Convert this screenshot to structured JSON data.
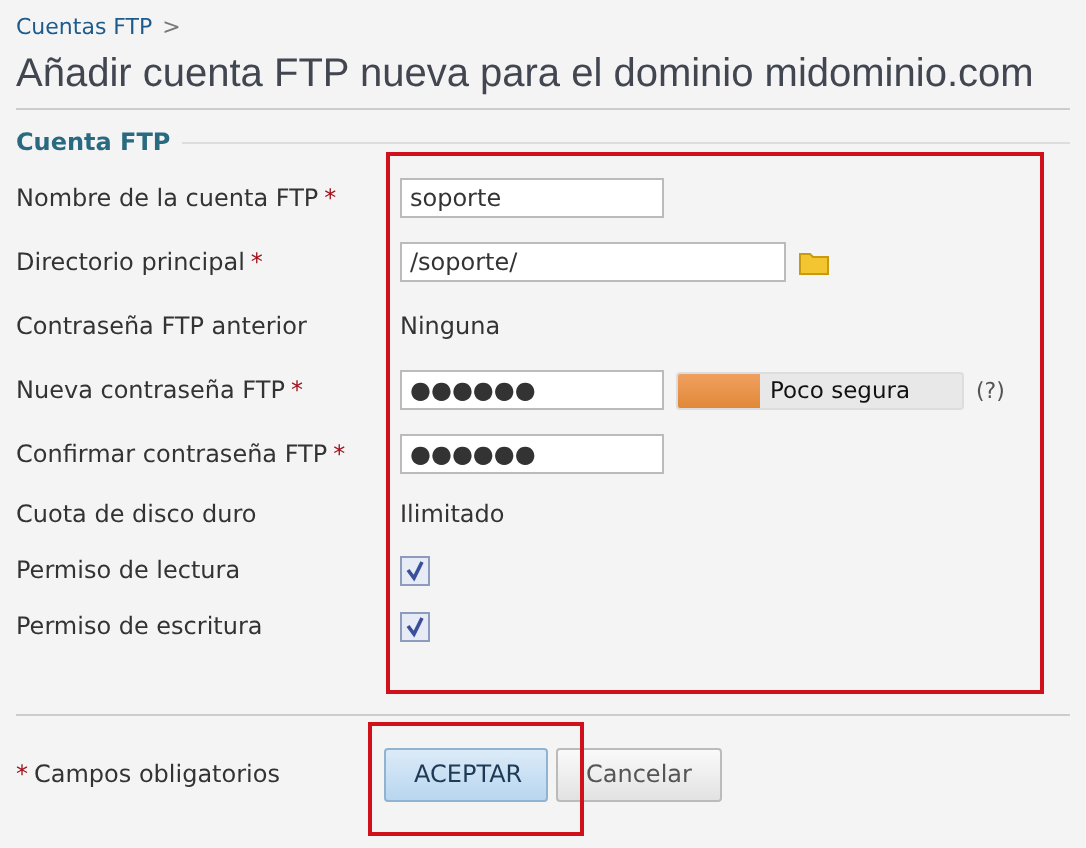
{
  "breadcrumb": {
    "link": "Cuentas FTP",
    "separator": ">"
  },
  "title": "Añadir cuenta FTP nueva para el dominio midominio.com",
  "section": "Cuenta FTP",
  "rows": [
    {
      "kind": "text",
      "label": "Nombre de la cuenta FTP",
      "mark": "*",
      "value": "soporte"
    },
    {
      "kind": "folder",
      "label": "Directorio principal",
      "mark": "*",
      "value": "/soporte/"
    },
    {
      "kind": "static",
      "label": "Contraseña FTP anterior",
      "value": "Ninguna"
    },
    {
      "kind": "meter",
      "label": "Nueva contraseña FTP",
      "mark": "*",
      "value": "●●●●●●",
      "level": 0.29,
      "reading": "Poco segura",
      "help": "(?)"
    },
    {
      "kind": "text",
      "label": "Confirmar contraseña FTP",
      "mark": "*",
      "value": "●●●●●●"
    },
    {
      "kind": "static",
      "label": "Cuota de disco duro",
      "value": "Ilimitado"
    },
    {
      "kind": "checkbox",
      "label": "Permiso de lectura",
      "checked": true
    },
    {
      "kind": "checkbox",
      "label": "Permiso de escritura",
      "checked": true
    }
  ],
  "footer": {
    "mark": "*",
    "note": "Campos obligatorios",
    "buttons": [
      {
        "label": "ACEPTAR",
        "kind": "primary"
      },
      {
        "label": "Cancelar",
        "kind": "secondary"
      }
    ]
  }
}
